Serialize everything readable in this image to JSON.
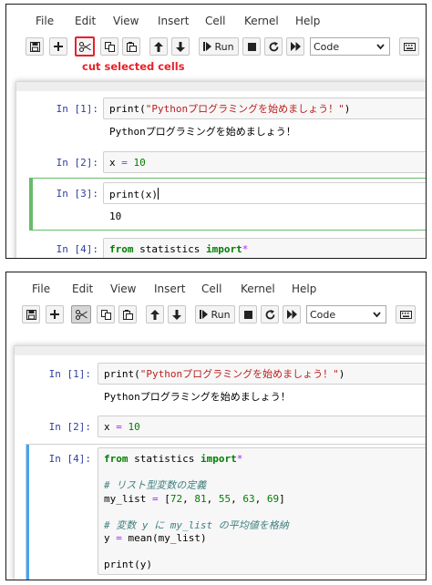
{
  "menu": [
    "File",
    "Edit",
    "View",
    "Insert",
    "Cell",
    "Kernel",
    "Help"
  ],
  "toolbar": {
    "run_label": "Run",
    "cell_type": "Code",
    "buttons": [
      "save-icon",
      "plus-icon",
      "scissors-icon",
      "copy-icon",
      "paste-icon",
      "arrow-up-icon",
      "arrow-down-icon",
      "step-forward-icon",
      "stop-icon",
      "restart-icon",
      "fast-forward-icon",
      "keyboard-icon"
    ]
  },
  "annotation": "cut selected cells",
  "colors": {
    "highlight": "#e8212a",
    "edit_mode": "#66bb6a",
    "command_mode": "#42a5f5",
    "prompt": "#303f9f"
  },
  "top": {
    "cells": [
      {
        "prompt": "In [1]:",
        "code": {
          "fn": "print",
          "open": "(",
          "str": "\"Pythonプログラミングを始めましょう！\"",
          "close": ")"
        },
        "output": "Pythonプログラミングを始めましょう！"
      },
      {
        "prompt": "In [2]:",
        "code": {
          "var": "x",
          "op": "=",
          "num": "10"
        }
      },
      {
        "prompt": "In [3]:",
        "code": {
          "fn": "print",
          "open": "(",
          "arg": "x",
          "close": ")"
        },
        "output": "10"
      },
      {
        "prompt": "In [4]:",
        "code": {
          "kw1": "from",
          "mod": "statistics",
          "kw2": "import",
          "star": "*"
        }
      }
    ]
  },
  "bottom": {
    "cells": [
      {
        "prompt": "In [1]:",
        "code": {
          "fn": "print",
          "open": "(",
          "str": "\"Pythonプログラミングを始めましょう！\"",
          "close": ")"
        },
        "output": "Pythonプログラミングを始めましょう！"
      },
      {
        "prompt": "In [2]:",
        "code": {
          "var": "x",
          "op": "=",
          "num": "10"
        }
      },
      {
        "prompt": "In [4]:",
        "lines": {
          "l1": {
            "kw1": "from",
            "mod": "statistics",
            "kw2": "import",
            "star": "*"
          },
          "comment1": "# リスト型変数の定義",
          "l2": {
            "var": "my_list",
            "op": "=",
            "open": "[",
            "n1": "72",
            "n2": "81",
            "n3": "55",
            "n4": "63",
            "n5": "69",
            "close": "]"
          },
          "comment2": "# 変数 y に my_list の平均値を格納",
          "l3": {
            "var": "y",
            "op": "=",
            "call": "mean(my_list)"
          },
          "l4": {
            "fn": "print",
            "arg": "(y)"
          }
        }
      }
    ]
  }
}
